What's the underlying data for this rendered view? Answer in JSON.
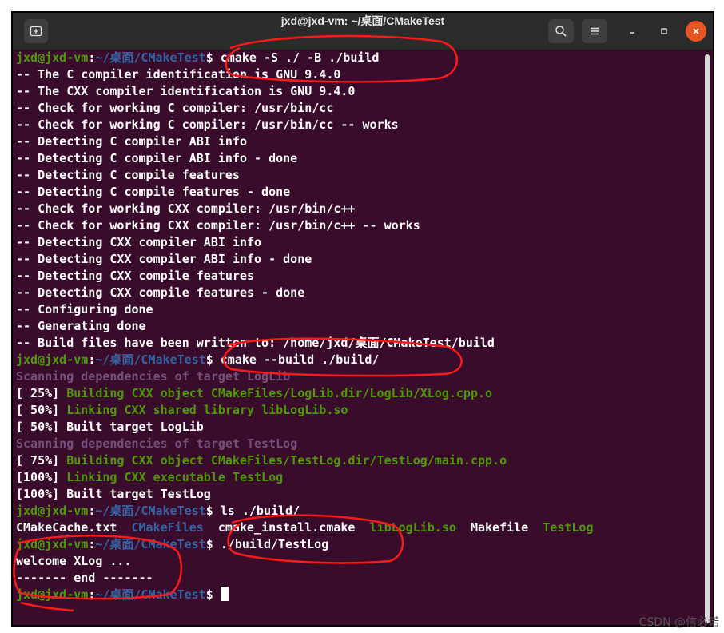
{
  "window": {
    "title": "jxd@jxd-vm: ~/桌面/CMakeTest",
    "new_tab_icon": "new-tab-icon",
    "search_icon": "search-icon",
    "menu_icon": "hamburger-menu-icon",
    "minimize_icon": "minimize-icon",
    "maximize_icon": "maximize-icon",
    "close_icon": "close-icon",
    "close_color": "#e95420"
  },
  "prompt": {
    "user": "jxd@jxd-vm",
    "path": "~/桌面/CMakeTest"
  },
  "lines": [
    {
      "type": "prompt",
      "cmd": "cmake -S ./ -B ./build"
    },
    {
      "type": "text",
      "text": "-- The C compiler identification is GNU 9.4.0"
    },
    {
      "type": "text",
      "text": "-- The CXX compiler identification is GNU 9.4.0"
    },
    {
      "type": "text",
      "text": "-- Check for working C compiler: /usr/bin/cc"
    },
    {
      "type": "text",
      "text": "-- Check for working C compiler: /usr/bin/cc -- works"
    },
    {
      "type": "text",
      "text": "-- Detecting C compiler ABI info"
    },
    {
      "type": "text",
      "text": "-- Detecting C compiler ABI info - done"
    },
    {
      "type": "text",
      "text": "-- Detecting C compile features"
    },
    {
      "type": "text",
      "text": "-- Detecting C compile features - done"
    },
    {
      "type": "text",
      "text": "-- Check for working CXX compiler: /usr/bin/c++"
    },
    {
      "type": "text",
      "text": "-- Check for working CXX compiler: /usr/bin/c++ -- works"
    },
    {
      "type": "text",
      "text": "-- Detecting CXX compiler ABI info"
    },
    {
      "type": "text",
      "text": "-- Detecting CXX compiler ABI info - done"
    },
    {
      "type": "text",
      "text": "-- Detecting CXX compile features"
    },
    {
      "type": "text",
      "text": "-- Detecting CXX compile features - done"
    },
    {
      "type": "text",
      "text": "-- Configuring done"
    },
    {
      "type": "text",
      "text": "-- Generating done"
    },
    {
      "type": "text",
      "text": "-- Build files have been written to: /home/jxd/桌面/CMakeTest/build"
    },
    {
      "type": "prompt",
      "cmd": "cmake --build ./build/"
    },
    {
      "type": "purple",
      "text": "Scanning dependencies of target LogLib"
    },
    {
      "type": "build",
      "prefix": "[ 25%] ",
      "text": "Building CXX object CMakeFiles/LogLib.dir/LogLib/XLog.cpp.o"
    },
    {
      "type": "build",
      "prefix": "[ 50%] ",
      "text": "Linking CXX shared library libLogLib.so"
    },
    {
      "type": "text",
      "text": "[ 50%] Built target LogLib"
    },
    {
      "type": "purple",
      "text": "Scanning dependencies of target TestLog"
    },
    {
      "type": "build",
      "prefix": "[ 75%] ",
      "text": "Building CXX object CMakeFiles/TestLog.dir/TestLog/main.cpp.o"
    },
    {
      "type": "build",
      "prefix": "[100%] ",
      "text": "Linking CXX executable TestLog"
    },
    {
      "type": "text",
      "text": "[100%] Built target TestLog"
    },
    {
      "type": "prompt",
      "cmd": "ls ./build/"
    },
    {
      "type": "ls",
      "items": [
        {
          "name": "CMakeCache.txt",
          "color": "white"
        },
        {
          "name": "CMakeFiles",
          "color": "blue"
        },
        {
          "name": "cmake_install.cmake",
          "color": "white"
        },
        {
          "name": "libLogLib.so",
          "color": "green"
        },
        {
          "name": "Makefile",
          "color": "white"
        },
        {
          "name": "TestLog",
          "color": "green"
        }
      ]
    },
    {
      "type": "prompt",
      "cmd": "./build/TestLog"
    },
    {
      "type": "text",
      "text": "welcome XLog ..."
    },
    {
      "type": "text",
      "text": "------- end -------"
    },
    {
      "type": "prompt",
      "cmd": "",
      "cursor": true
    }
  ],
  "watermark": "CSDN @信必诺",
  "colors": {
    "background": "#3a0c2c",
    "green": "#4e9a06",
    "blue": "#3465a4",
    "purple": "#75507b",
    "annotation": "#ff1a1a"
  }
}
